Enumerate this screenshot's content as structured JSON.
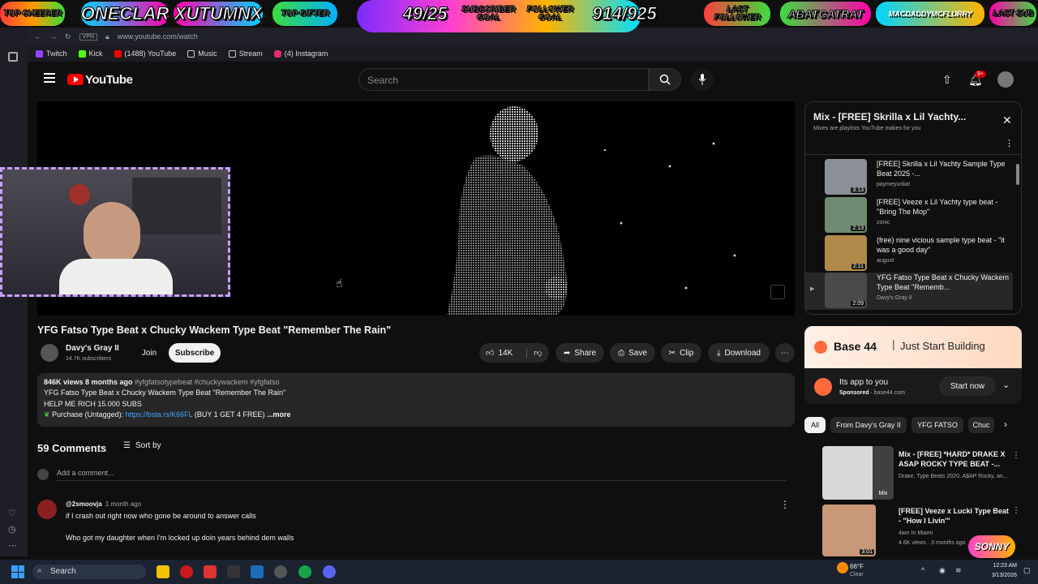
{
  "overlay": {
    "top_cheerer": "TOP CHEERER",
    "name1": "ONECLAR",
    "name2": "XUTUMNX",
    "top_gifter": "TOP GIFTER",
    "sub_count": "49/25",
    "sub_goal": "SUBSCRIBER GOAL",
    "follower_goal": "FOLLOWER GOAL",
    "follower_count": "914/925",
    "last_follower": "LAST FOLLOWER",
    "last_follower_name": "ABATCATRAT",
    "last_sub_name": "MACDADDYMCFLURRY",
    "last_sub": "LAST SUB"
  },
  "browser": {
    "url": "www.youtube.com/watch",
    "vpn": "VPN",
    "bookmarks": [
      "Twitch",
      "Kick",
      "(1488) YouTube",
      "Music",
      "Stream",
      "(4) Instagram"
    ]
  },
  "yt": {
    "logo": "YouTube",
    "search_placeholder": "Search",
    "notif_count": "9+"
  },
  "video": {
    "title": "YFG Fatso Type Beat x Chucky Wackem Type Beat \"Remember The Rain\"",
    "channel": "Davy's Gray II",
    "subs": "14.7K subscribers",
    "join": "Join",
    "subscribe": "Subscribe",
    "likes": "14K",
    "share": "Share",
    "save": "Save",
    "clip": "Clip",
    "download": "Download"
  },
  "description": {
    "stats": "846K views  8 months ago",
    "tags": " #yfgfatsotypebeat #chuckywackem #yfgfatso",
    "line1": "YFG Fatso Type Beat x Chucky Wackem Type Beat \"Remember The Rain\"",
    "line2": "HELP ME RICH 15.000 SUBS",
    "purchase": "Purchase (Untagged): ",
    "link": "https://bsta.rs/K66FL",
    "after_link": " (BUY 1 GET 4 FREE)",
    "more": "...more"
  },
  "comments": {
    "count": "59 Comments",
    "sort": "Sort by",
    "add": "Add a comment...",
    "first": {
      "author": "@2smoovja",
      "time": "1 month ago",
      "line1": "if I crash out right now who gone be around to answer calls",
      "line2": "Who got my daughter when I'm locked up doin years  behind dem walls"
    }
  },
  "playlist": {
    "title": "Mix - [FREE] Skrilla x Lil Yachty...",
    "subtitle": "Mixes are playlists YouTube makes for you",
    "items": [
      {
        "title": "[FREE] Skrilla x Lil Yachty Sample Type Beat 2025 -...",
        "channel": "paymeyunka!",
        "duration": "3:13",
        "color": "#8a8f98"
      },
      {
        "title": "[FREE] Veeze x Lil Yachty type beat - \"Bring The Mop\"",
        "channel": "zonic",
        "duration": "2:13",
        "color": "#6f8a70"
      },
      {
        "title": "(free) nine vicious sample type beat - \"it was a good day\"",
        "channel": "auguxt",
        "duration": "2:11",
        "color": "#b08a4a"
      },
      {
        "title": "YFG Fatso Type Beat x Chucky Wackem Type Beat \"Rememb...",
        "channel": "Davy's Gray II",
        "duration": "2:09",
        "color": "#4a4a4a"
      }
    ]
  },
  "ad": {
    "brand": "Base 44",
    "tagline": "Just Start Building",
    "headline": "Its app to you",
    "sponsored": "Sponsored",
    "domain": "base44.com",
    "cta": "Start now"
  },
  "chips": [
    "All",
    "From Davy's Gray II",
    "YFG FATSO",
    "Chuc"
  ],
  "related": [
    {
      "title": "Mix - [FREE] *HARD* DRAKE X ASAP ROCKY TYPE BEAT -...",
      "meta": "Drake, Type Beats 2020, A$AP Rocky, an...",
      "badge": "Mix"
    },
    {
      "title": "[FREE] Veeze x Lucki Type Beat - \"How I Livin'\"",
      "meta": "4am In Miami",
      "meta2": "4.6K views · 3 months ago",
      "badge": "3:01"
    }
  ],
  "taskbar": {
    "search": "Search",
    "weather_temp": "66°F",
    "weather_desc": "Clear",
    "time": "12:23 AM",
    "date": "3/13/2026",
    "sonny": "SONNY"
  },
  "colors": {
    "yt_red": "#ff0000",
    "subscribe_bg": "#f1f1f1",
    "link": "#3ea6ff",
    "ad_accent": "#ff6a3d"
  }
}
